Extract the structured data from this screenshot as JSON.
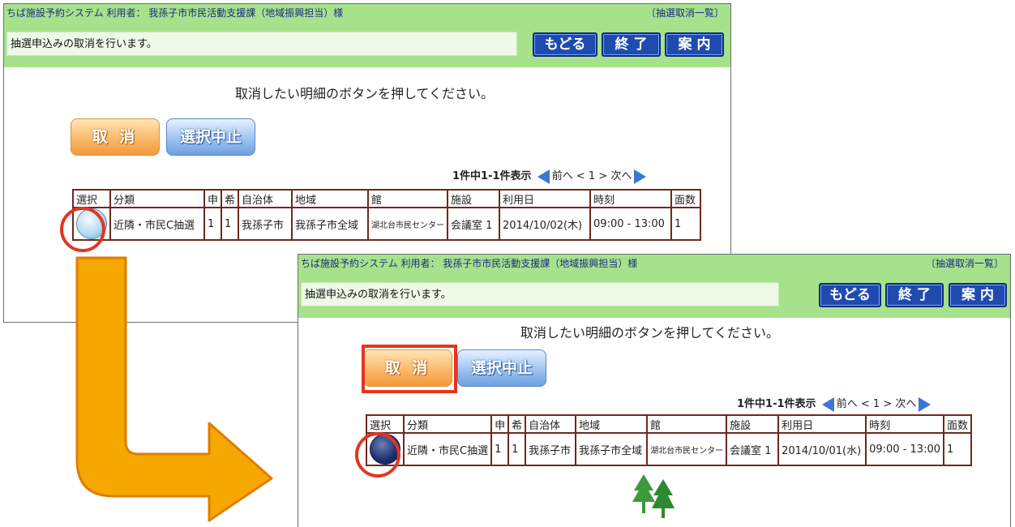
{
  "header": {
    "title": "ちば施設予約システム 利用者： 我孫子市市民活動支援課（地域振興担当）様",
    "screen_id": "〔抽選取消一覧〕"
  },
  "message": "抽選申込みの取消を行います。",
  "nav": {
    "back": "もどる",
    "exit": "終 了",
    "guide": "案 内"
  },
  "instruction": "取消したい明細のボタンを押してください。",
  "buttons": {
    "cancel": "取 消",
    "stop": "選択中止"
  },
  "pager": {
    "count": "1件中1-1件表示",
    "prev": "前へ",
    "pages": "< 1 >",
    "next": "次へ"
  },
  "table": {
    "headers": [
      "選択",
      "分類",
      "申",
      "希",
      "自治体",
      "地域",
      "館",
      "施設",
      "利用日",
      "時刻",
      "面数"
    ]
  },
  "rows": [
    {
      "category": "近隣・市民C抽選",
      "app": "1",
      "pref": "1",
      "municipality": "我孫子市",
      "area": "我孫子市全域",
      "hall": "湖北台市民センター",
      "facility": "会議室 1",
      "date": "2014/10/02(木)",
      "time": "09:00 - 13:00",
      "count": "1"
    },
    {
      "category": "近隣・市民C抽選",
      "app": "1",
      "pref": "1",
      "municipality": "我孫子市",
      "area": "我孫子市全域",
      "hall": "湖北台市民センター",
      "facility": "会議室 1",
      "date": "2014/10/01(水)",
      "time": "09:00 - 13:00",
      "count": "1"
    }
  ],
  "colors": {
    "header_green": "#a6e28b",
    "nav_blue": "#1f4bb0",
    "highlight_red": "#e2361f",
    "arrow_orange": "#f6a800"
  }
}
